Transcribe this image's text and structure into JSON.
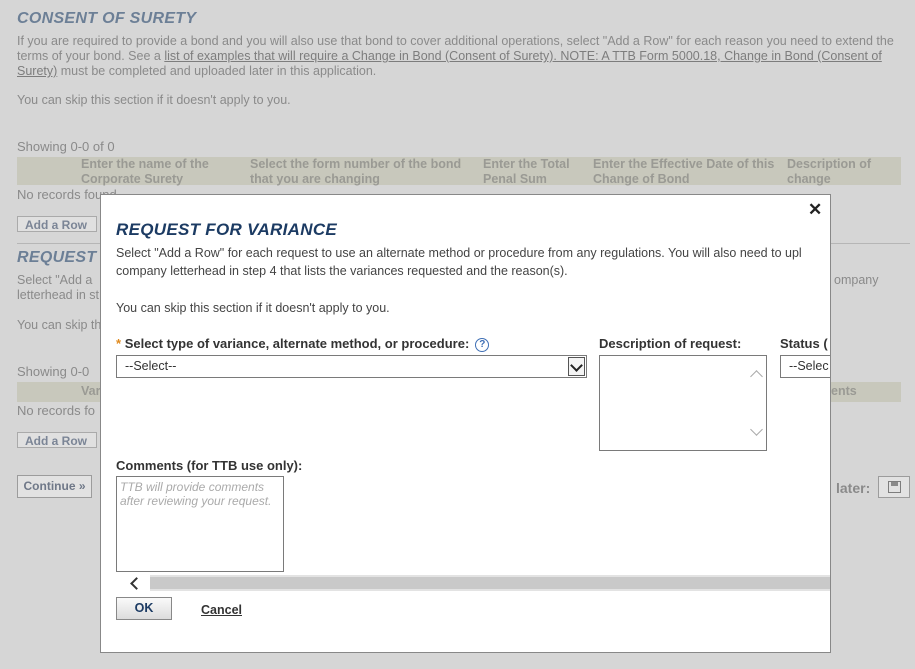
{
  "background": {
    "consent": {
      "title": "CONSENT OF SURETY",
      "intro_part1": "If you are required to provide a bond and you will also use that bond to cover additional operations, select \"Add a Row\" for each reason you need to extend the terms of your bond. See a ",
      "intro_link": "list of examples that will require a Change in Bond (Consent of Surety). NOTE: A TTB Form 5000.18, Change in Bond (Consent of Surety)",
      "intro_part2": " must be completed and uploaded later in this application.",
      "skip": "You can skip this section if it doesn't apply to you.",
      "showing": "Showing 0-0 of 0",
      "columns": [
        "Enter the name of the Corporate Surety",
        "Select the form number of the bond that you are changing",
        "Enter the Total Penal Sum",
        "Enter the Effective Date of this Change of Bond",
        "Description of change"
      ],
      "no_records": "No records found",
      "add_row": "Add a Row"
    },
    "variance": {
      "title_partial": "REQUEST",
      "intro_partial_1": "Select \"Add a",
      "intro_partial_right": "ompany",
      "intro_partial_2": "letterhead in st",
      "skip_partial": "You can skip th",
      "showing_partial": "Showing 0-0",
      "col_partial_left": "Var",
      "col_partial_right": "ents",
      "no_records_partial": "No records fo",
      "add_row": "Add a Row"
    },
    "continue_label": "Continue »",
    "later_label": "later:"
  },
  "modal": {
    "title": "REQUEST FOR VARIANCE",
    "intro_line1": "Select \"Add a Row\" for each request to use an alternate method or procedure from any regulations. You will also need to upl",
    "intro_line2": "company letterhead in step 4 that lists the variances requested and the reason(s).",
    "skip": "You can skip this section if it doesn't apply to you.",
    "close_symbol": "✕",
    "type_field": {
      "required_mark": "*",
      "label": "Select type of variance, alternate method, or procedure:",
      "help_symbol": "?",
      "value": "--Select--"
    },
    "description_field": {
      "label": "Description of request:"
    },
    "status_field": {
      "label": "Status (",
      "value": "--Selec"
    },
    "comments_field": {
      "label": "Comments (for TTB use only):",
      "placeholder": "TTB will provide comments after reviewing your request."
    },
    "ok_label": "OK",
    "cancel_label": "Cancel"
  }
}
